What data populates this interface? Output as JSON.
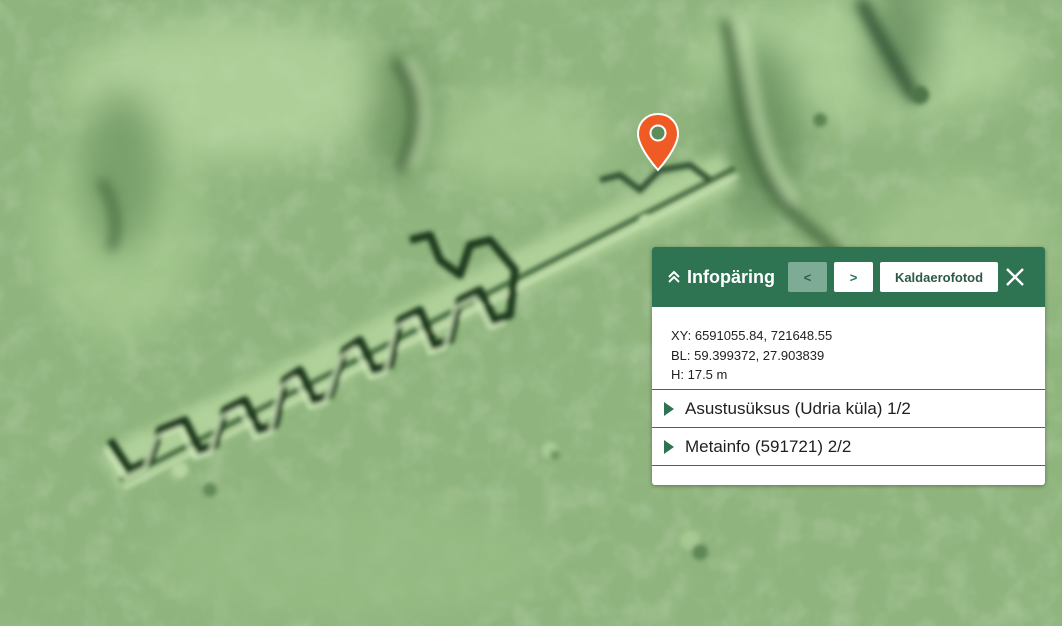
{
  "map": {
    "marker_icon": "map-pin-icon",
    "colors": {
      "terrain": "#8fb47d",
      "marker": "#f05a24"
    }
  },
  "panel": {
    "title": "Infopäring",
    "collapse_icon": "double-chevron-up-icon",
    "prev_label": "<",
    "next_label": ">",
    "oblique_label": "Kaldaerofotod",
    "close_icon": "close-icon",
    "coords": {
      "xy": "XY: 6591055.84, 721648.55",
      "bl": "BL: 59.399372, 27.903839",
      "h": "H: 17.5 m"
    },
    "sections": [
      {
        "label": "Asustusüksus (Udria küla) 1/2"
      },
      {
        "label": "Metainfo (591721) 2/2"
      }
    ],
    "colors": {
      "header": "#2e7352",
      "prev_button": "#7eab95"
    }
  }
}
